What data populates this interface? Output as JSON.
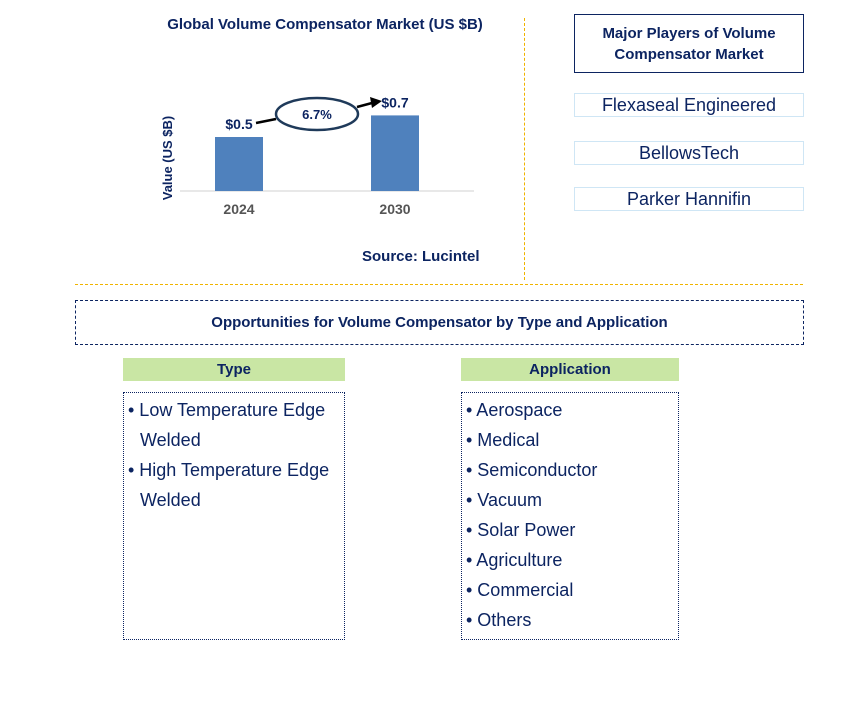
{
  "chart_data": {
    "type": "bar",
    "title": "Global Volume Compensator Market (US $B)",
    "ylabel": "Value (US $B)",
    "categories": [
      "2024",
      "2030"
    ],
    "values": [
      0.5,
      0.7
    ],
    "data_labels": [
      "$0.5",
      "$0.7"
    ],
    "cagr_label": "6.7%",
    "bar_color": "#4f81bd",
    "source": "Source: Lucintel"
  },
  "players": {
    "title": "Major Players of Volume Compensator Market",
    "items": [
      "Flexaseal Engineered",
      "BellowsTech",
      "Parker Hannifin"
    ]
  },
  "opportunities": {
    "title": "Opportunities for Volume Compensator by Type and Application",
    "type": {
      "heading": "Type",
      "items": [
        "• Low Temperature Edge Welded",
        "• High Temperature Edge Welded"
      ]
    },
    "application": {
      "heading": "Application",
      "items": [
        "• Aerospace",
        "• Medical",
        "• Semiconductor",
        "• Vacuum",
        "• Solar Power",
        "• Agriculture",
        "• Commercial",
        "• Others"
      ]
    }
  }
}
